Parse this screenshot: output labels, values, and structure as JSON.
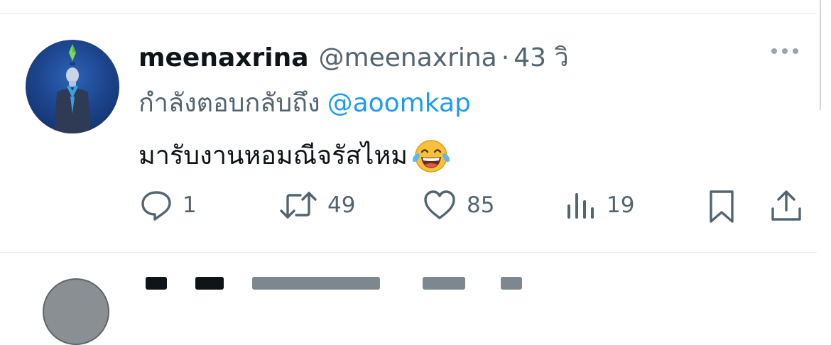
{
  "tweet": {
    "display_name": "meenaxrina",
    "handle": "@meenaxrina",
    "separator": "·",
    "time": "43 วิ",
    "replying_to_label": "กำลังตอบกลับถึง",
    "replying_to_handle": "@aoomkap",
    "text": "มารับงานหอมณีจรัสไหม",
    "emoji_icon": "face-with-tears-of-joy",
    "actions": {
      "reply_count": "1",
      "retweet_count": "49",
      "like_count": "85",
      "views_count": "19"
    }
  },
  "colors": {
    "text_primary": "#0f1419",
    "text_secondary": "#536471",
    "link": "#1d9bf0",
    "divider": "#e6e8ea"
  }
}
